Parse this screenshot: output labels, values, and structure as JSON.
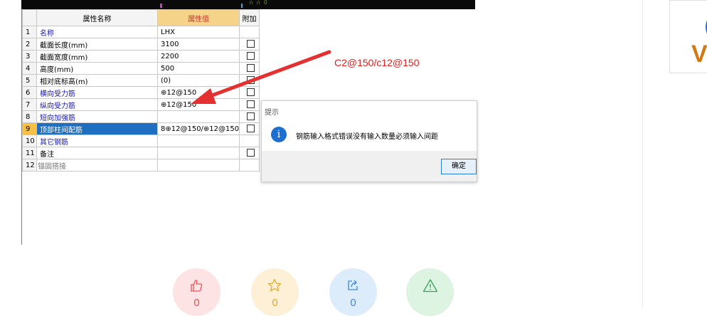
{
  "topbar": {
    "text": "∩ ∩ 0"
  },
  "grid": {
    "headers": {
      "name": "属性名称",
      "value": "属性值",
      "extra": "附加"
    },
    "rows": [
      {
        "num": "1",
        "name": "名称",
        "value": "LHX",
        "checkbox": false,
        "blue": true
      },
      {
        "num": "2",
        "name": "截面长度(mm)",
        "value": "3100",
        "checkbox": true,
        "blue": false
      },
      {
        "num": "3",
        "name": "截面宽度(mm)",
        "value": "2200",
        "checkbox": true,
        "blue": false
      },
      {
        "num": "4",
        "name": "高度(mm)",
        "value": "500",
        "checkbox": true,
        "blue": false
      },
      {
        "num": "5",
        "name": "相对底标高(m)",
        "value": "(0)",
        "checkbox": true,
        "blue": false
      },
      {
        "num": "6",
        "name": "横向受力筋",
        "value": "⊕12@150",
        "checkbox": true,
        "blue": true
      },
      {
        "num": "7",
        "name": "纵向受力筋",
        "value": "⊕12@150",
        "checkbox": true,
        "blue": true
      },
      {
        "num": "8",
        "name": "短向加强筋",
        "value": "",
        "checkbox": true,
        "blue": true
      },
      {
        "num": "9",
        "name": "顶部柱间配筋",
        "value": "8⊕12@150/⊕12@150",
        "checkbox": true,
        "selected": true
      },
      {
        "num": "10",
        "name": "其它钢筋",
        "value": "",
        "checkbox": false,
        "blue": true
      },
      {
        "num": "11",
        "name": "备注",
        "value": "",
        "checkbox": true,
        "blue": false
      },
      {
        "num": "12",
        "name": "锚固搭接",
        "value": "",
        "checkbox": false,
        "grey": true,
        "expandable": true,
        "expand_symbol": "+"
      }
    ]
  },
  "annotation": {
    "text": "C2@150/c12@150",
    "color": "#e02020"
  },
  "dialog": {
    "title": "提示",
    "icon": "info-icon",
    "message": "钢筋输入格式错误没有输入数量必须输入间距",
    "ok_label": "确定"
  },
  "actions": [
    {
      "icon": "thumbs-up-icon",
      "count": "0",
      "color": "#e9545a"
    },
    {
      "icon": "star-icon",
      "count": "0",
      "color": "#e8a72c"
    },
    {
      "icon": "share-icon",
      "count": "0",
      "color": "#3f8ad8"
    },
    {
      "icon": "warning-icon",
      "count": "",
      "color": "#3aa35a"
    }
  ],
  "logo": {
    "letter": "V"
  }
}
